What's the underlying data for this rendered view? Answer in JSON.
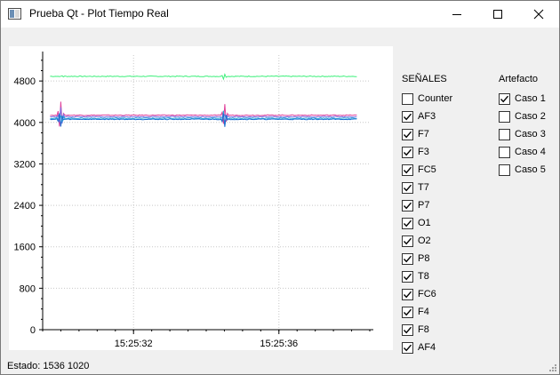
{
  "window": {
    "title": "Prueba Qt - Plot Tiempo Real"
  },
  "icons": {
    "app": "app-window-icon",
    "minimize": "minimize-icon",
    "maximize": "maximize-icon",
    "close": "close-icon",
    "checkmark": "checkmark-icon",
    "size_grip": "size-grip-icon"
  },
  "signals": {
    "title": "SEÑALES",
    "items": [
      {
        "label": "Counter",
        "checked": false
      },
      {
        "label": "AF3",
        "checked": true
      },
      {
        "label": "F7",
        "checked": true
      },
      {
        "label": "F3",
        "checked": true
      },
      {
        "label": "FC5",
        "checked": true
      },
      {
        "label": "T7",
        "checked": true
      },
      {
        "label": "P7",
        "checked": true
      },
      {
        "label": "O1",
        "checked": true
      },
      {
        "label": "O2",
        "checked": true
      },
      {
        "label": "P8",
        "checked": true
      },
      {
        "label": "T8",
        "checked": true
      },
      {
        "label": "FC6",
        "checked": true
      },
      {
        "label": "F4",
        "checked": true
      },
      {
        "label": "F8",
        "checked": true
      },
      {
        "label": "AF4",
        "checked": true
      }
    ]
  },
  "artefacto": {
    "title": "Artefacto",
    "items": [
      {
        "label": "Caso 1",
        "checked": true
      },
      {
        "label": "Caso 2",
        "checked": false
      },
      {
        "label": "Caso 3",
        "checked": false
      },
      {
        "label": "Caso 4",
        "checked": false
      },
      {
        "label": "Caso 5",
        "checked": false
      }
    ]
  },
  "status": {
    "text": "Estado: 1536 1020"
  },
  "chart_data": {
    "type": "line",
    "title": "",
    "xlabel": "",
    "ylabel": "",
    "ylim": [
      0,
      5300
    ],
    "x_range": [
      "15:25:29.5",
      "15:25:38.5"
    ],
    "y_ticks": [
      "0",
      "800",
      "1600",
      "2400",
      "3200",
      "4000",
      "4800"
    ],
    "x_ticks": [
      "15:25:32",
      "15:25:36"
    ],
    "grid": true,
    "series": [
      {
        "color": "#3cf07a",
        "base": 4890,
        "spikes": [
          {
            "t": "15:25:30",
            "amp": 60
          },
          {
            "t": "15:25:34.5",
            "amp": 60
          }
        ]
      },
      {
        "color": "#e0409a",
        "base": 4140,
        "spikes": [
          {
            "t": "15:25:30",
            "amp": 320
          },
          {
            "t": "15:25:34.5",
            "amp": 240
          }
        ]
      },
      {
        "color": "#7a6fe0",
        "base": 4110,
        "spikes": [
          {
            "t": "15:25:30",
            "amp": 200
          },
          {
            "t": "15:25:34.5",
            "amp": 180
          }
        ]
      },
      {
        "color": "#20a8d8",
        "base": 4080,
        "spikes": [
          {
            "t": "15:25:30",
            "amp": 260
          },
          {
            "t": "15:25:34.5",
            "amp": 200
          }
        ]
      },
      {
        "color": "#1f6fd0",
        "base": 4060,
        "spikes": [
          {
            "t": "15:25:30",
            "amp": 180
          },
          {
            "t": "15:25:34.5",
            "amp": 160
          }
        ]
      }
    ]
  }
}
